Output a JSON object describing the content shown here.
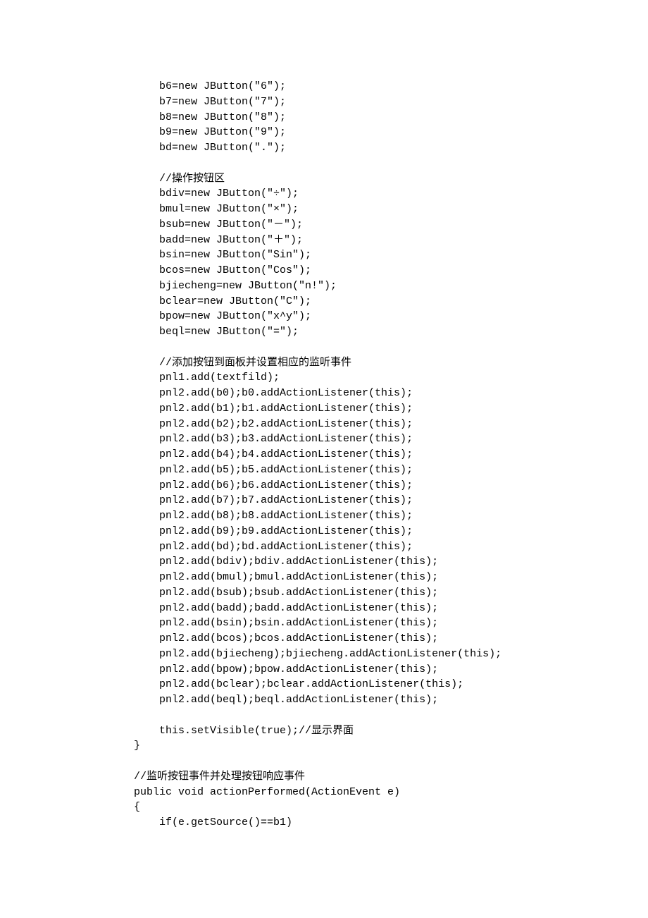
{
  "code_lines": [
    "    b6=new JButton(\"6\");",
    "    b7=new JButton(\"7\");",
    "    b8=new JButton(\"8\");",
    "    b9=new JButton(\"9\");",
    "    bd=new JButton(\".\");",
    "",
    "    //操作按钮区",
    "    bdiv=new JButton(\"÷\");",
    "    bmul=new JButton(\"×\");",
    "    bsub=new JButton(\"－\");",
    "    badd=new JButton(\"＋\");",
    "    bsin=new JButton(\"Sin\");",
    "    bcos=new JButton(\"Cos\");",
    "    bjiecheng=new JButton(\"n!\");",
    "    bclear=new JButton(\"C\");",
    "    bpow=new JButton(\"x^y\");",
    "    beql=new JButton(\"=\");",
    "",
    "    //添加按钮到面板并设置相应的监听事件",
    "    pnl1.add(textfild);",
    "    pnl2.add(b0);b0.addActionListener(this);",
    "    pnl2.add(b1);b1.addActionListener(this);",
    "    pnl2.add(b2);b2.addActionListener(this);",
    "    pnl2.add(b3);b3.addActionListener(this);",
    "    pnl2.add(b4);b4.addActionListener(this);",
    "    pnl2.add(b5);b5.addActionListener(this);",
    "    pnl2.add(b6);b6.addActionListener(this);",
    "    pnl2.add(b7);b7.addActionListener(this);",
    "    pnl2.add(b8);b8.addActionListener(this);",
    "    pnl2.add(b9);b9.addActionListener(this);",
    "    pnl2.add(bd);bd.addActionListener(this);",
    "    pnl2.add(bdiv);bdiv.addActionListener(this);",
    "    pnl2.add(bmul);bmul.addActionListener(this);",
    "    pnl2.add(bsub);bsub.addActionListener(this);",
    "    pnl2.add(badd);badd.addActionListener(this);",
    "    pnl2.add(bsin);bsin.addActionListener(this);",
    "    pnl2.add(bcos);bcos.addActionListener(this);",
    "    pnl2.add(bjiecheng);bjiecheng.addActionListener(this);",
    "    pnl2.add(bpow);bpow.addActionListener(this);",
    "    pnl2.add(bclear);bclear.addActionListener(this);",
    "    pnl2.add(beql);beql.addActionListener(this);",
    "",
    "    this.setVisible(true);//显示界面",
    "}",
    "",
    "//监听按钮事件并处理按钮响应事件",
    "public void actionPerformed(ActionEvent e)",
    "{",
    "    if(e.getSource()==b1)"
  ]
}
